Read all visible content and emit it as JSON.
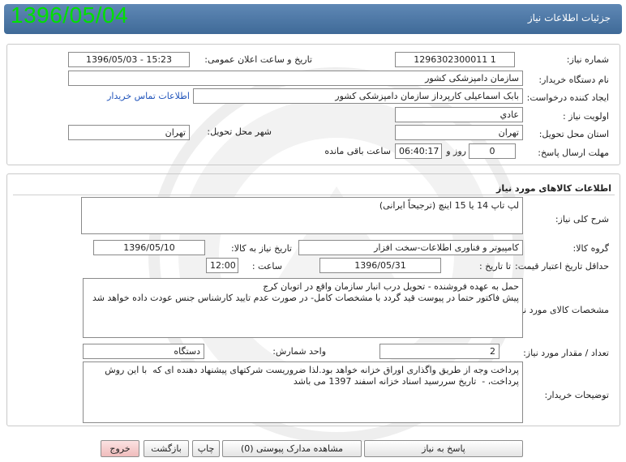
{
  "header": {
    "title": "جزئیات اطلاعات نیاز",
    "date_stamp": "1396/05/04"
  },
  "request": {
    "need_number_label": "شماره نیاز:",
    "need_number": "1296302300011 1",
    "announce_label": "تاریخ و ساعت اعلان عمومی:",
    "announce_value": "1396/05/03 - 15:23",
    "buyer_org_label": "نام دستگاه خریدار:",
    "buyer_org": "سازمان دامپزشکی کشور",
    "creator_label": "ایجاد کننده درخواست:",
    "creator": "بابک اسماعیلی کارپرداز سازمان دامپزشکی کشور",
    "contact_link": "اطلاعات تماس خریدار",
    "priority_label": "اولویت نیاز :",
    "priority": "عادي",
    "province_label": "استان محل تحویل:",
    "province": "تهران",
    "city_label": "شهر محل تحویل:",
    "city": "تهران",
    "deadline_label": "مهلت ارسال پاسخ:",
    "days_value": "0",
    "days_label": "روز و",
    "time_value": "06:40:17",
    "remaining_label": "ساعت باقی مانده"
  },
  "goods": {
    "section_title": "اطلاعات کالاهای مورد نیاز",
    "summary_label": "شرح کلی نیاز:",
    "summary": "لپ تاپ 14 یا 15 اینچ (ترجیحاً ایرانی)",
    "group_label": "گروه کالا:",
    "group": "کامپیوتر و فناوری اطلاعات-سخت افزار",
    "need_date_label": "تاریخ نیاز به کالا:",
    "need_date": "1396/05/10",
    "validity_label": "حداقل تاریخ اعتبار قیمت:",
    "until_label": "تا تاریخ :",
    "validity_date": "1396/05/31",
    "hour_label": "ساعت :",
    "validity_time": "12:00",
    "specs_label": "مشخصات کالای مورد نیاز:",
    "specs": "حمل به عهده فروشنده - تحویل درب انبار سازمان واقع در اتوبان کرج\nپیش فاکتور حتما در پیوست قید گردد با مشخصات کامل- در صورت عدم تایید کارشناس جنس عودت داده خواهد شد",
    "qty_label": "تعداد / مقدار مورد نیاز:",
    "qty": "2",
    "unit_label": "واحد شمارش:",
    "unit": "دستگاه",
    "notes_label": "توضیحات خریدار:",
    "notes": "پرداخت وجه از طریق واگذاری اوراق خزانه خواهد بود.لذا ضروریست شرکتهای پیشنهاد دهنده ای که  با این روش پرداخت، -  تاریخ سررسید اسناد خزانه اسفند 1397 می باشد"
  },
  "footer": {
    "reply": "پاسخ به نیاز",
    "attachments": "مشاهده مدارک پیوستی (0)",
    "print": "چاپ",
    "back": "بازگشت",
    "exit": "خروج"
  }
}
